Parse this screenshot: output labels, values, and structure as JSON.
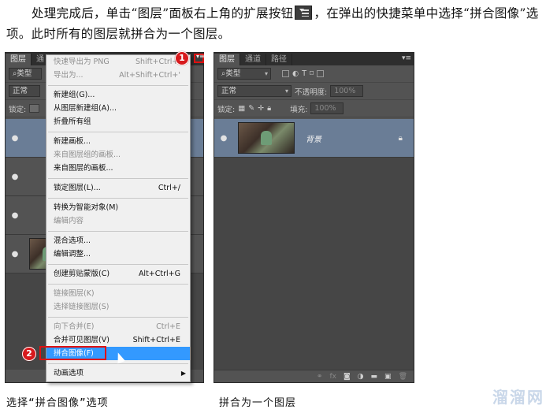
{
  "intro": {
    "before_icon": "处理完成后，单击“图层”面板右上角的扩展按钮",
    "after_icon": "，在弹出的快捷菜单中选择“拼合图像”选项。此时所有的图层就拼合为一个图层。"
  },
  "left_panel": {
    "tabs": [
      "图层",
      "通"
    ],
    "filter_label": "类型",
    "blend_mode": "正常",
    "lock_label": "锁定:"
  },
  "right_panel": {
    "tabs": [
      "图层",
      "通道",
      "路径"
    ],
    "filter_label": "类型",
    "blend_mode": "正常",
    "opacity_label": "不透明度:",
    "opacity_value": "100%",
    "lock_label": "锁定:",
    "fill_label": "填充:",
    "fill_value": "100%",
    "layer_name": "背景"
  },
  "menu_groups": [
    [
      {
        "label": "快速导出为 PNG",
        "shortcut": "Shift+Ctrl+'",
        "disabled": true
      },
      {
        "label": "导出为...",
        "shortcut": "Alt+Shift+Ctrl+'",
        "disabled": true
      }
    ],
    [
      {
        "label": "新建组(G)...",
        "shortcut": "",
        "disabled": false
      },
      {
        "label": "从图层新建组(A)...",
        "shortcut": "",
        "disabled": false
      },
      {
        "label": "折叠所有组",
        "shortcut": "",
        "disabled": false
      }
    ],
    [
      {
        "label": "新建画板...",
        "shortcut": "",
        "disabled": false
      },
      {
        "label": "来自图层组的画板...",
        "shortcut": "",
        "disabled": true
      },
      {
        "label": "来自图层的画板...",
        "shortcut": "",
        "disabled": false
      }
    ],
    [
      {
        "label": "锁定图层(L)...",
        "shortcut": "Ctrl+/",
        "disabled": false
      }
    ],
    [
      {
        "label": "转换为智能对象(M)",
        "shortcut": "",
        "disabled": false
      },
      {
        "label": "编辑内容",
        "shortcut": "",
        "disabled": true
      }
    ],
    [
      {
        "label": "混合选项...",
        "shortcut": "",
        "disabled": false
      },
      {
        "label": "编辑调整...",
        "shortcut": "",
        "disabled": false
      }
    ],
    [
      {
        "label": "创建剪贴蒙版(C)",
        "shortcut": "Alt+Ctrl+G",
        "disabled": false
      }
    ],
    [
      {
        "label": "链接图层(K)",
        "shortcut": "",
        "disabled": true
      },
      {
        "label": "选择链接图层(S)",
        "shortcut": "",
        "disabled": true
      }
    ],
    [
      {
        "label": "向下合并(E)",
        "shortcut": "Ctrl+E",
        "disabled": true
      },
      {
        "label": "合并可见图层(V)",
        "shortcut": "Shift+Ctrl+E",
        "disabled": false
      },
      {
        "label": "拼合图像(F)",
        "shortcut": "",
        "disabled": false,
        "highlighted": true
      }
    ],
    [
      {
        "label": "动画选项",
        "shortcut": "",
        "disabled": false,
        "submenu": true
      }
    ]
  ],
  "badges": [
    "1",
    "2"
  ],
  "captions": {
    "left": "选择“拼合图像”选项",
    "right": "拼合为一个图层"
  },
  "watermark": "溜溜网"
}
